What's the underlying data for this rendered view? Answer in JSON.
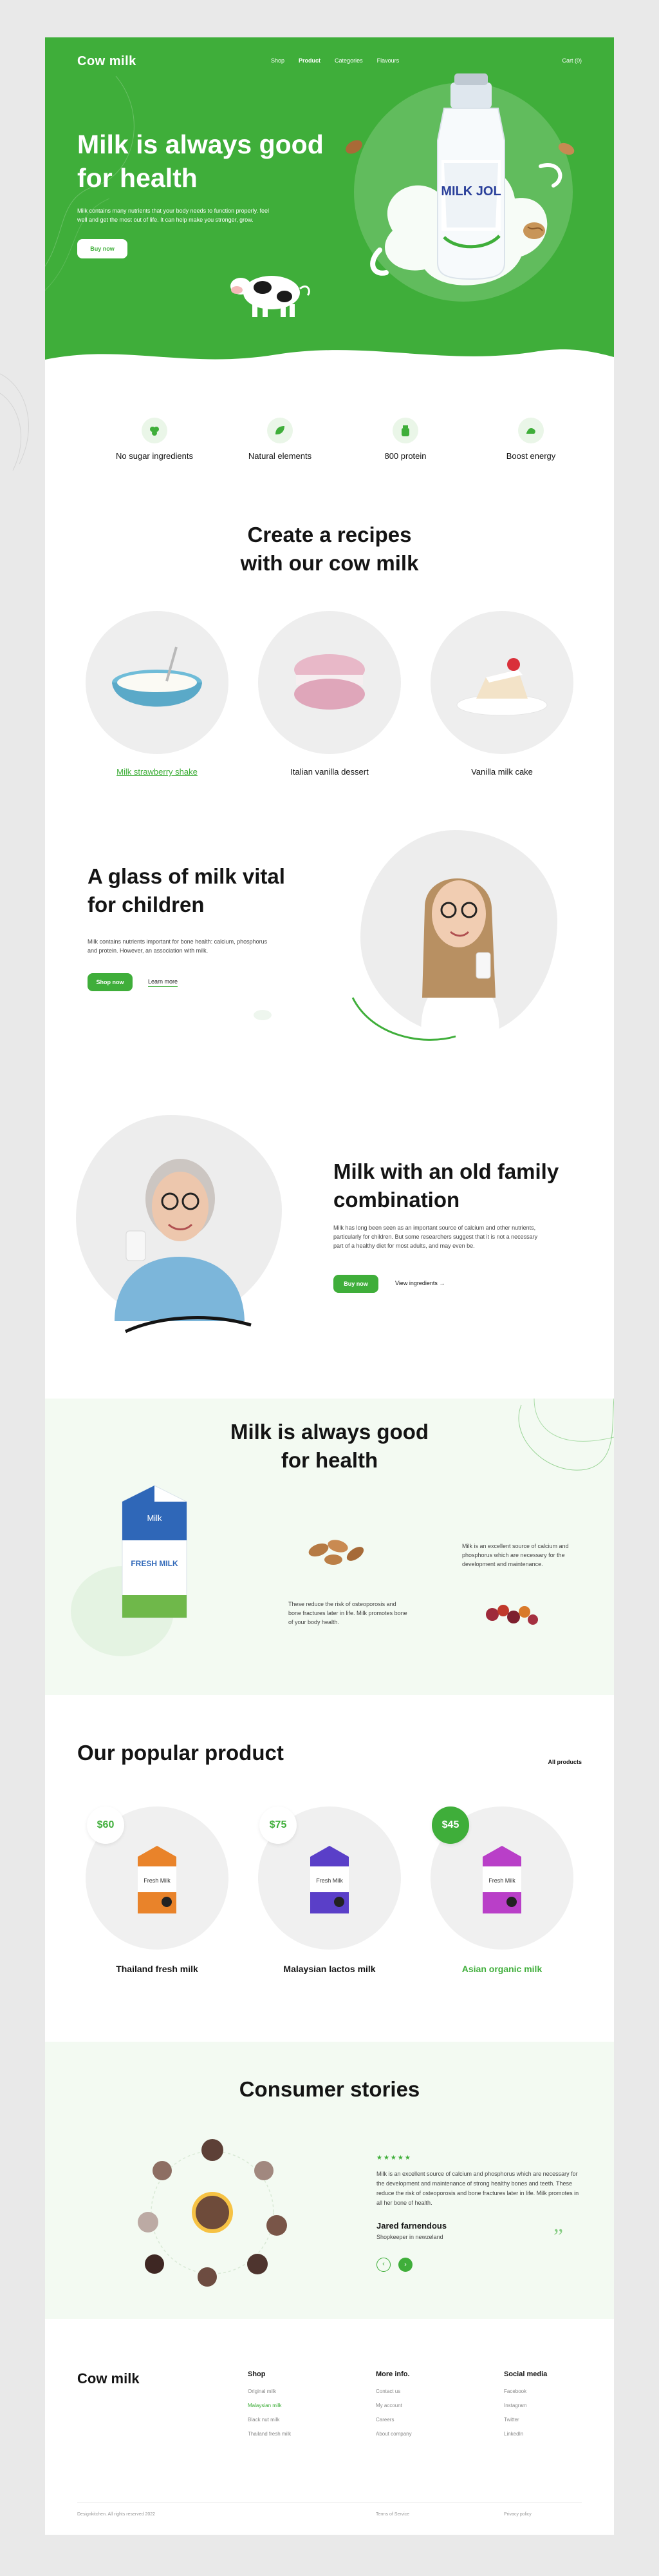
{
  "colors": {
    "accent": "#3fae3a",
    "accent_light": "#eaf6e8",
    "band": "#f3faf2"
  },
  "nav": {
    "logo": "Cow milk",
    "links": [
      "Shop",
      "Product",
      "Categories",
      "Flavours"
    ],
    "active_link": "Product",
    "cart": "Cart (0)"
  },
  "hero": {
    "title": "Milk is always good for health",
    "description": "Milk contains many nutrients that your body needs to function properly. feel well and get the most out of life. It can help make you stronger, grow.",
    "button": "Buy now",
    "bottle_label": "MILK JOL"
  },
  "features": [
    {
      "label": "No sugar ingredients",
      "icon": "grapes-icon"
    },
    {
      "label": "Natural elements",
      "icon": "leaf-icon"
    },
    {
      "label": "800 protein",
      "icon": "bottle-icon"
    },
    {
      "label": "Boost energy",
      "icon": "muscle-icon"
    }
  ],
  "recipes": {
    "title": "Create a recipes with our cow milk",
    "items": [
      {
        "label": "Milk strawberry shake",
        "active": true
      },
      {
        "label": "Italian vanilla dessert",
        "active": false
      },
      {
        "label": "Vanilla milk cake",
        "active": false
      }
    ]
  },
  "children": {
    "title": "A glass of milk vital for children",
    "description": "Milk contains nutrients important for bone health: calcium, phosphorus and protein. However, an association with milk.",
    "primary_button": "Shop now",
    "secondary_link": "Learn more"
  },
  "family": {
    "title": "Milk with an old family combination",
    "description": "Milk has long been seen as an important source of calcium and other nutrients, particularly for children. But some researchers suggest that it is not a necessary part of a healthy diet for most adults, and may even be.",
    "primary_button": "Buy now",
    "secondary_link": "View ingredients"
  },
  "health": {
    "title": "Milk is always good for health",
    "carton_brand": "Milk",
    "carton_text": "FRESH MILK",
    "text_left": "These reduce the risk of osteoporosis and bone fractures later in life. Milk promotes bone of your body health.",
    "text_right": "Milk is an excellent source of calcium and phosphorus which are necessary for the development and maintenance."
  },
  "products": {
    "title": "Our popular product",
    "all_link": "All products",
    "carton_text": "Fresh Milk",
    "items": [
      {
        "price": "$60",
        "label": "Thailand fresh milk",
        "active": false,
        "color": "#e9832a"
      },
      {
        "price": "$75",
        "label": "Malaysian lactos milk",
        "active": false,
        "color": "#5a3fc8"
      },
      {
        "price": "$45",
        "label": "Asian organic milk",
        "active": true,
        "color": "#b93fc8"
      }
    ]
  },
  "stories": {
    "title": "Consumer stories",
    "stars": "★★★★★",
    "quote": "Milk is an excellent source of calcium and phosphorus which are necessary for the development and maintenance of strong healthy bones and teeth. These reduce the risk of osteoporosis and bone fractures later in life. Milk promotes in all her bone of health.",
    "author": "Jared farnendous",
    "role": "Shopkeeper in newzeland",
    "quote_mark": "”"
  },
  "footer": {
    "logo": "Cow milk",
    "columns": [
      {
        "title": "Shop",
        "items": [
          "Original milk",
          "Malaysian milk",
          "Black nut milk",
          "Thailand fresh milk"
        ],
        "active_index": 1
      },
      {
        "title": "More info.",
        "items": [
          "Contact us",
          "My account",
          "Careers",
          "About company"
        ],
        "active_index": -1
      },
      {
        "title": "Social media",
        "items": [
          "Facebook",
          "Instagram",
          "Twitter",
          "LinkedIn"
        ],
        "active_index": -1
      }
    ],
    "copyright": "Designkitchen. All rights reserved 2022",
    "terms": "Terms of Service",
    "privacy": "Privacy policy"
  }
}
